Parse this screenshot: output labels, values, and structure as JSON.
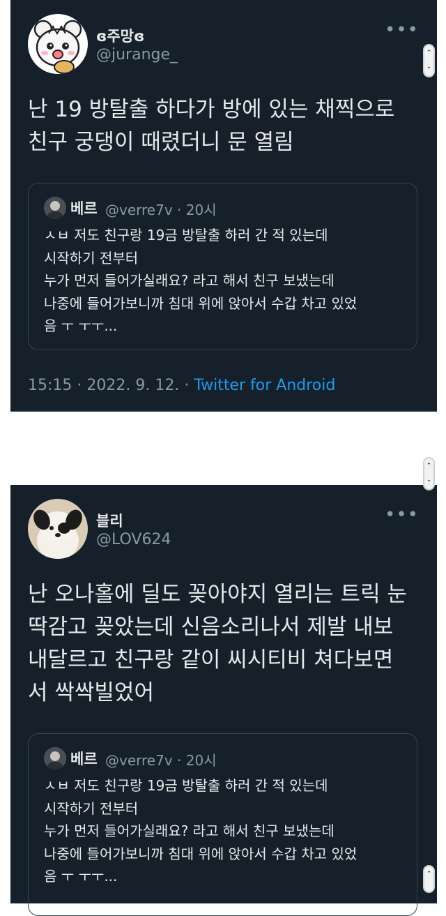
{
  "tweets": [
    {
      "name": "ɞ주망ɞ",
      "handle": "@jurange_",
      "more": "•••",
      "text_lines": [
        "난 19 방탈출 하다가 방에 있는 채찍으로",
        "친구 궁댕이 때렸더니 문 열림"
      ],
      "quote": {
        "name": "베르",
        "handle": "@verre7v",
        "time": "· 20시",
        "lines": [
          "ㅅㅂ 저도 친구랑 19금 방탈출 하러 간 적 있는데",
          "시작하기 전부터",
          "누가 먼저 들어가실래요? 라고 해서 친구 보냈는데",
          "나중에 들어가보니까 침대 위에 앉아서 수갑 차고 있었",
          "음 ㅜ ㅜㅜ..."
        ]
      },
      "meta": {
        "time": "15:15 · 2022. 9. 12. ·",
        "source": "Twitter for Android"
      }
    },
    {
      "name": "블리",
      "handle": "@LOV624",
      "more": "•••",
      "text_lines": [
        "난 오나홀에 딜도 꽂아야지 열리는 트릭 눈",
        "딱감고 꽂았는데 신음소리나서 제발 내보",
        "내달르고 친구랑 같이 씨시티비 쳐다보면",
        "서 싹싹빌었어"
      ],
      "quote": {
        "name": "베르",
        "handle": "@verre7v",
        "time": "· 20시",
        "lines": [
          "ㅅㅂ 저도 친구랑 19금 방탈출 하러 간 적 있는데",
          "시작하기 전부터",
          "누가 먼저 들어가실래요? 라고 해서 친구 보냈는데",
          "나중에 들어가보니까 침대 위에 앉아서 수갑 차고 있었",
          "음 ㅜ ㅜㅜ..."
        ]
      }
    }
  ],
  "scrollbar": {
    "up": "⌃",
    "down": "⌄"
  }
}
